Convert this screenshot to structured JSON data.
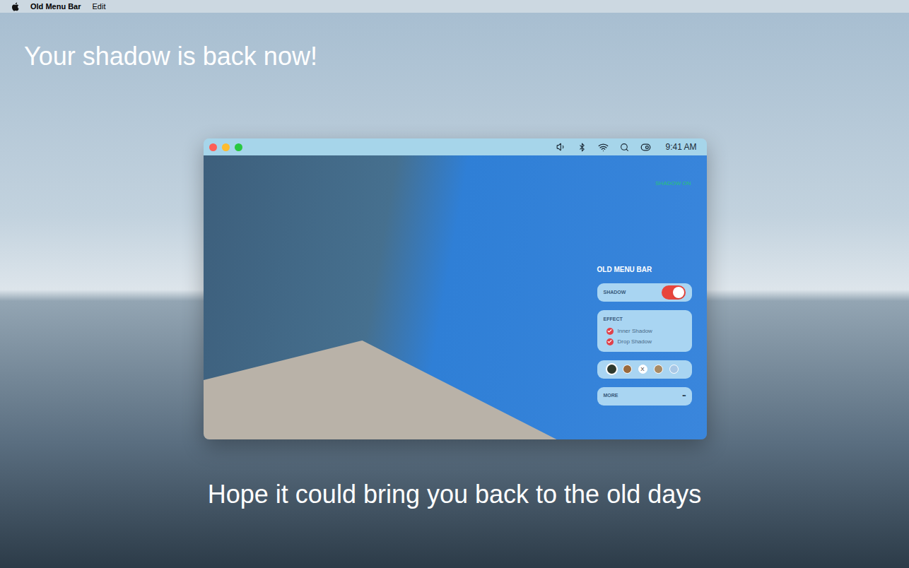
{
  "menubar": {
    "app": "Old Menu Bar",
    "items": [
      "Edit"
    ]
  },
  "headline": "Your shadow is back now!",
  "window": {
    "traffic_lights": [
      {
        "color": "#fe5f57"
      },
      {
        "color": "#febc2e"
      },
      {
        "color": "#28c840"
      }
    ],
    "clock": "9:41 AM",
    "status": "SHADOW ON",
    "panel": {
      "title": "OLD MENU BAR",
      "shadow": {
        "label": "SHADOW",
        "on": true
      },
      "effect": {
        "label": "EFFECT",
        "options": [
          {
            "label": "Inner Shadow",
            "checked": true
          },
          {
            "label": "Drop Shadow",
            "checked": true
          }
        ]
      },
      "themes": [
        {
          "mark": "",
          "color": "#2f3a2e",
          "selected": true
        },
        {
          "mark": "",
          "color": "#9a6a3c",
          "selected": false
        },
        {
          "mark": "X",
          "color": "#ffffff",
          "selected": false
        },
        {
          "mark": "",
          "color": "#a88a64",
          "selected": false
        },
        {
          "mark": "",
          "color": "#a9c8e6",
          "selected": false
        }
      ],
      "more": {
        "label": "MORE",
        "icon": "•••"
      }
    }
  },
  "tagline": "Hope it could bring you back to the old days"
}
